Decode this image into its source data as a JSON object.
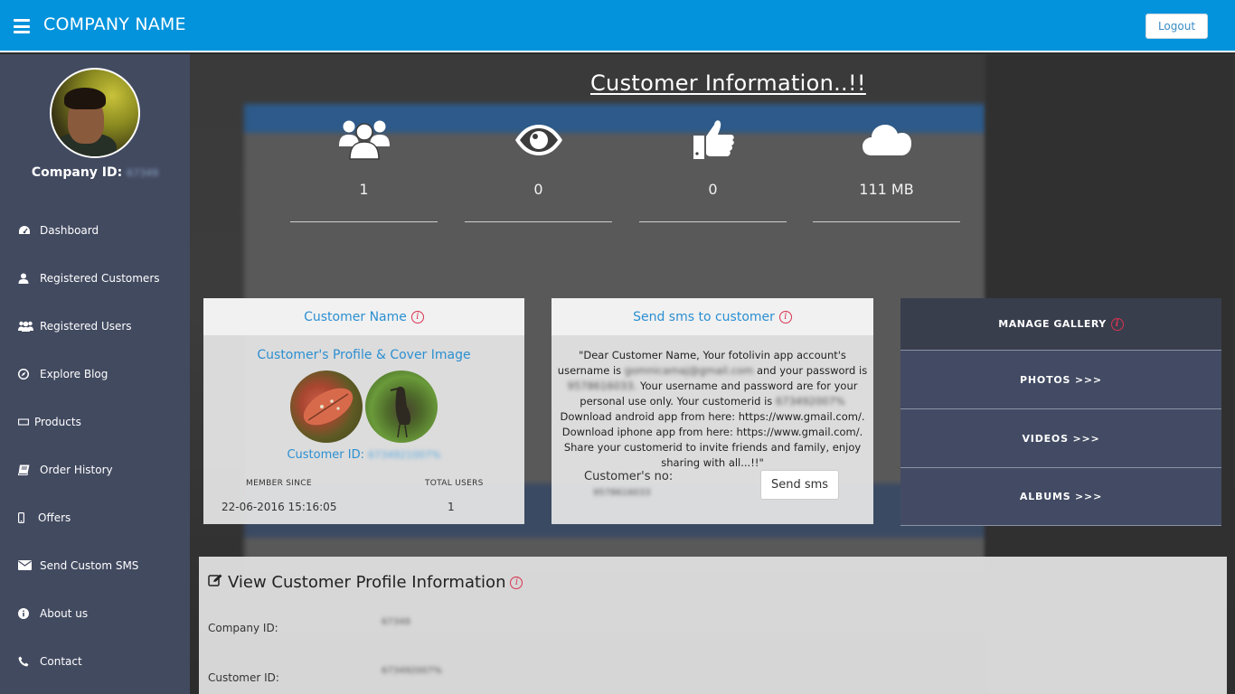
{
  "app": {
    "brand": "COMPANY NAME",
    "logout": "Logout"
  },
  "sidebar": {
    "company_id_label": "Company ID:",
    "company_id_value": "67349",
    "items": [
      {
        "label": "Dashboard",
        "icon": "dashboard-icon"
      },
      {
        "label": "Registered Customers",
        "icon": "user-icon"
      },
      {
        "label": "Registered Users",
        "icon": "users-icon"
      },
      {
        "label": "Explore Blog",
        "icon": "compass-icon"
      },
      {
        "label": "Products",
        "icon": "rectangle-icon"
      },
      {
        "label": "Order History",
        "icon": "book-icon"
      },
      {
        "label": "Offers",
        "icon": "mobile-icon"
      },
      {
        "label": "Send Custom SMS",
        "icon": "envelope-icon"
      },
      {
        "label": "About us",
        "icon": "info-icon"
      },
      {
        "label": "Contact",
        "icon": "phone-icon"
      }
    ]
  },
  "main": {
    "title": "Customer Information..!!",
    "stats": [
      {
        "icon": "users-icon",
        "value": "1"
      },
      {
        "icon": "eye-icon",
        "value": "0"
      },
      {
        "icon": "thumbs-up-icon",
        "value": "0"
      },
      {
        "icon": "cloud-icon",
        "value": "111 MB"
      }
    ]
  },
  "customer_card": {
    "title": "Customer Name",
    "profile_images_label": "Customer's Profile & Cover Image",
    "customer_id_label": "Customer ID:",
    "customer_id_value": "6734921007%",
    "member_since_label": "MEMBER SINCE",
    "member_since_value": "22-06-2016 15:16:05",
    "total_users_label": "TOTAL USERS",
    "total_users_value": "1"
  },
  "sms_card": {
    "title": "Send sms to customer",
    "msg_part1": "\"Dear Customer Name, Your fotolivin app account's username is",
    "msg_email": "gomnicamaj@gmail.com",
    "msg_part2": "and your password is",
    "msg_password": "9578616033.",
    "msg_part3": "Your username and password are for your personal use only. Your customerid is",
    "msg_custid": "673492007%",
    "msg_part4": "Download android app from here: https://www.gmail.com/. Download iphone app from here: https://www.gmail.com/. Share your customerid to invite friends and family, enjoy sharing with all...!!\"",
    "customer_no_label": "Customer's no:",
    "customer_no_value": "9578616033",
    "send_button": "Send sms"
  },
  "gallery": {
    "title": "MANAGE GALLERY",
    "items": [
      "PHOTOS >>>",
      "VIDEOS >>>",
      "ALBUMS >>>"
    ]
  },
  "profile_panel": {
    "title": "View Customer Profile Information",
    "company_id_label": "Company ID:",
    "company_id_value": "67349",
    "customer_id_label": "Customer ID:",
    "customer_id_value": "673492007%"
  },
  "colors": {
    "topbar": "#0393dc",
    "sidebar": "#424a60",
    "accent": "#2b8fd1",
    "info_red": "#d83350"
  }
}
